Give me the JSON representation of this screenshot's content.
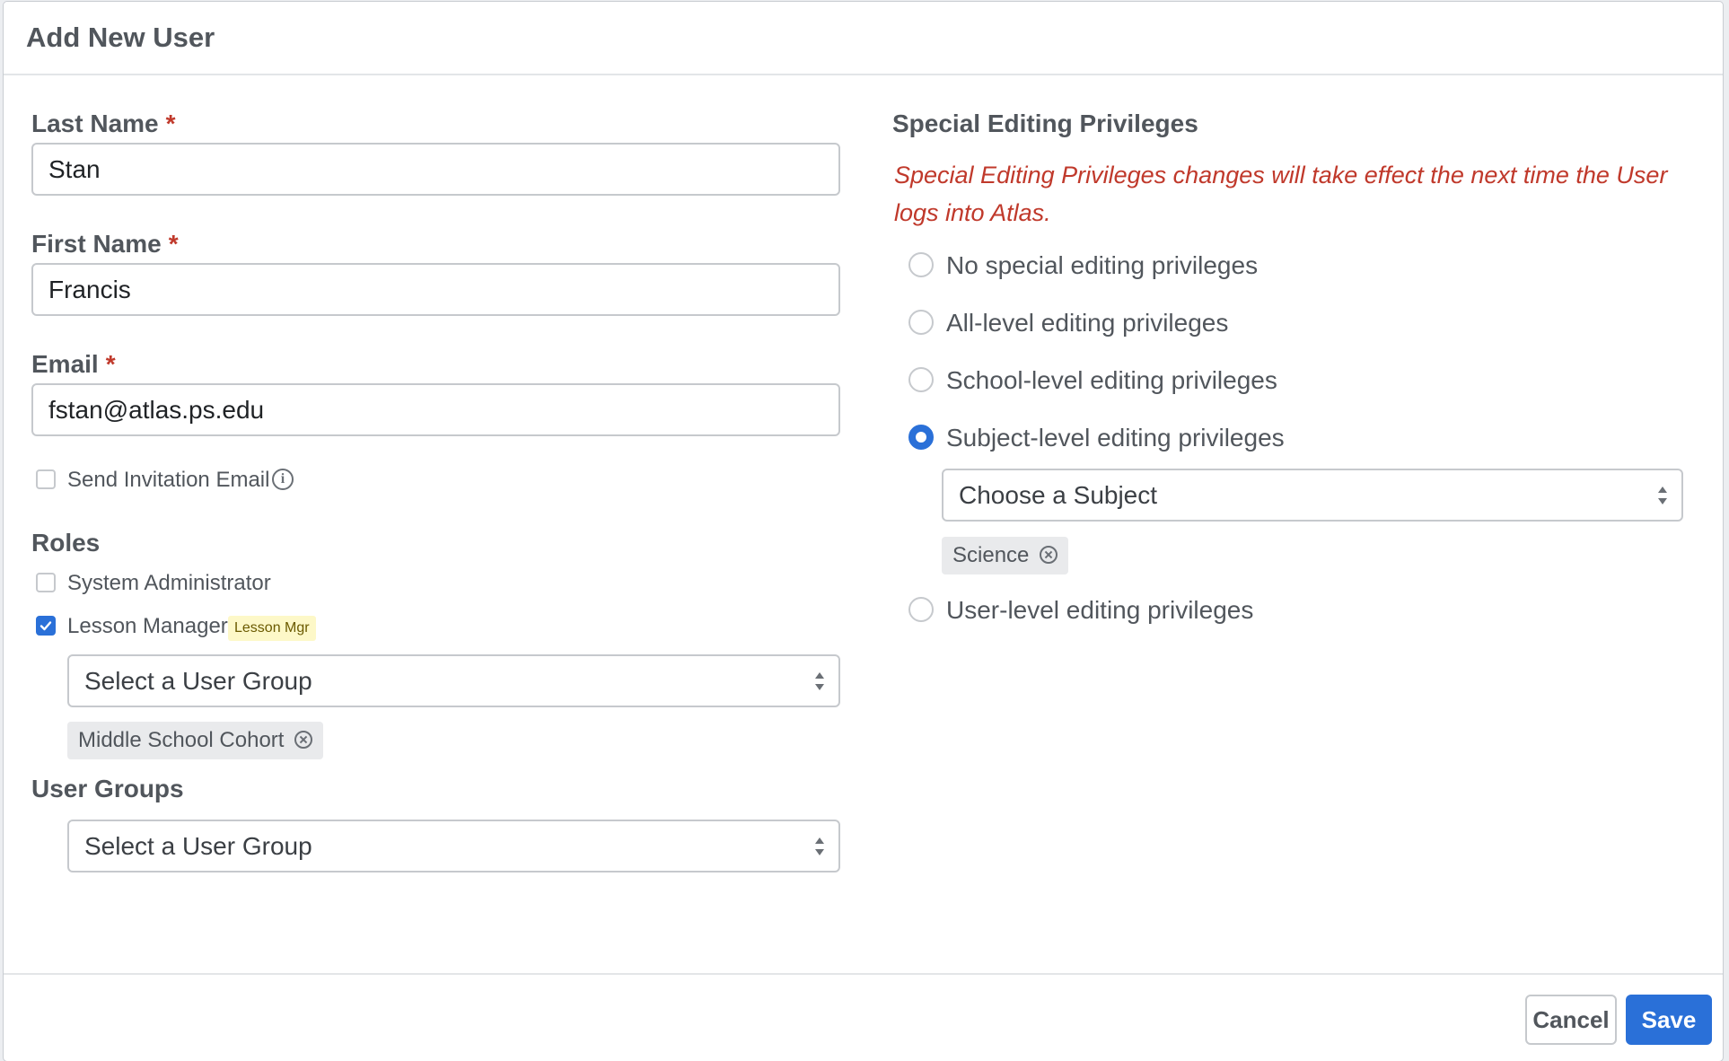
{
  "modal": {
    "title": "Add New User"
  },
  "form": {
    "last_name": {
      "label": "Last Name",
      "required_mark": "*",
      "value": "Stan"
    },
    "first_name": {
      "label": "First Name",
      "required_mark": "*",
      "value": "Francis"
    },
    "email": {
      "label": "Email",
      "required_mark": "*",
      "value": "fstan@atlas.ps.edu"
    },
    "send_invitation": {
      "label": "Send Invitation Email",
      "checked": false,
      "info_icon": "info-icon"
    }
  },
  "roles": {
    "heading": "Roles",
    "items": [
      {
        "label": "System Administrator",
        "checked": false
      },
      {
        "label": "Lesson Manager",
        "checked": true,
        "badge": "Lesson Mgr"
      }
    ],
    "lesson_manager_group_select": {
      "placeholder": "Select a User Group"
    },
    "lesson_manager_group_tags": [
      "Middle School Cohort"
    ]
  },
  "user_groups": {
    "heading": "User Groups",
    "select": {
      "placeholder": "Select a User Group"
    }
  },
  "privileges": {
    "heading": "Special Editing Privileges",
    "note": "Special Editing Privileges changes will take effect the next time the User logs into Atlas.",
    "options": [
      {
        "label": "No special editing privileges",
        "selected": false
      },
      {
        "label": "All-level editing privileges",
        "selected": false
      },
      {
        "label": "School-level editing privileges",
        "selected": false
      },
      {
        "label": "Subject-level editing privileges",
        "selected": true
      },
      {
        "label": "User-level editing privileges",
        "selected": false
      }
    ],
    "subject_select": {
      "placeholder": "Choose a Subject"
    },
    "subject_tags": [
      "Science"
    ]
  },
  "footer": {
    "cancel_label": "Cancel",
    "save_label": "Save"
  },
  "colors": {
    "accent": "#2a70d8",
    "required": "#c0392b",
    "badge_bg": "#fdf8c8"
  }
}
